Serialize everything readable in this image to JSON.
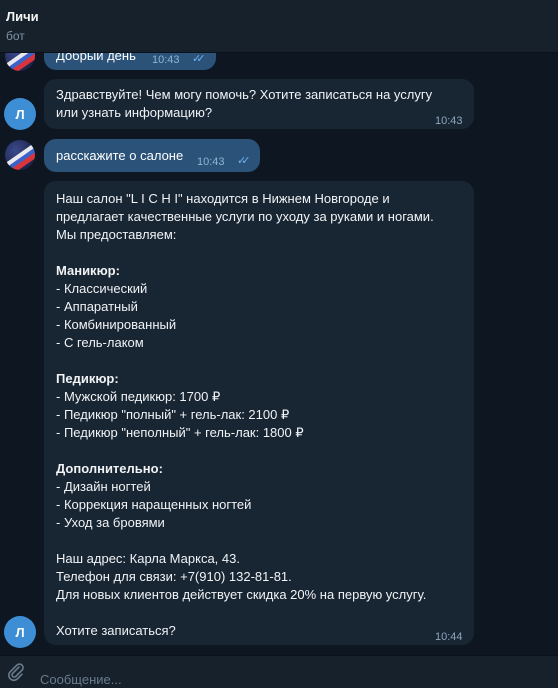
{
  "header": {
    "title": "Личи",
    "subtitle": "бот"
  },
  "messages": {
    "m1": {
      "text": "Добрый день",
      "time": "10:43"
    },
    "m2": {
      "text": "Здравствуйте! Чем могу помочь? Хотите записаться на услугу\nили узнать информацию?",
      "time": "10:43",
      "avatar": "Л"
    },
    "m3": {
      "text": "расскажите о салоне",
      "time": "10:43"
    },
    "m4": {
      "intro": "Наш салон \"L I C H I\" находится в Нижнем Новгороде и\nпредлагает качественные услуги по уходу за руками и ногами.\nМы предоставляем:",
      "manicure_title": "Маникюр:",
      "manicure_items": "- Классический\n- Аппаратный\n- Комбинированный\n- С гель-лаком",
      "pedicure_title": "Педикюр:",
      "pedicure_items": "- Мужской педикюр: 1700 ₽\n- Педикюр \"полный\" + гель-лак: 2100 ₽\n- Педикюр \"неполный\" + гель-лак: 1800 ₽",
      "extra_title": "Дополнительно:",
      "extra_items": "- Дизайн ногтей\n- Коррекция наращенных ногтей\n- Уход за бровями",
      "contacts": "Наш адрес: Карла Маркса, 43.\nТелефон для связи: +7(910) 132-81-81.\nДля новых клиентов действует скидка 20% на первую услугу.",
      "question": "Хотите записаться?",
      "time": "10:44",
      "avatar": "Л"
    }
  },
  "composer": {
    "placeholder": "Сообщение..."
  },
  "colors": {
    "background": "#0e1621",
    "outgoing": "#2b5278",
    "incoming": "#182533",
    "accent": "#3e8ed6"
  }
}
